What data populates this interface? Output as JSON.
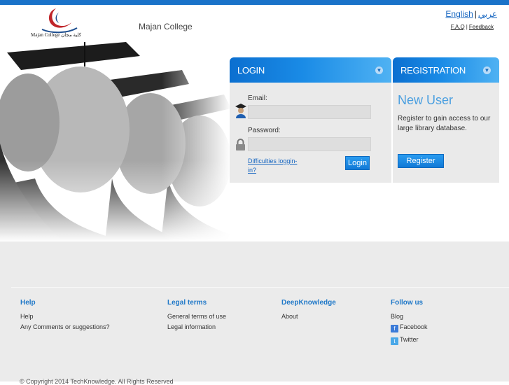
{
  "header": {
    "logo_caption": "Majan College كلية مجان",
    "site_title": "Majan College",
    "lang_english": "English",
    "lang_separator": "|",
    "lang_arabic": "عربي",
    "faq": "F.A.Q",
    "links_separator": "|",
    "feedback": "Feedback"
  },
  "login": {
    "title": "LOGIN",
    "email_label": "Email:",
    "password_label": "Password:",
    "difficulties_link": "Difficulties loggin-in?",
    "login_button": "Login"
  },
  "registration": {
    "title": "REGISTRATION",
    "heading": "New User",
    "text": "Register to gain access to our large library database.",
    "register_button": "Register"
  },
  "footer": {
    "columns": [
      {
        "title": "Help",
        "items": [
          "Help",
          "Any Comments or suggestions?"
        ]
      },
      {
        "title": "Legal terms",
        "items": [
          "General terms of use",
          "Legal information"
        ]
      },
      {
        "title": "DeepKnowledge",
        "items": [
          "About"
        ]
      },
      {
        "title": "Follow us",
        "items": [
          "Blog",
          "Facebook",
          "Twitter"
        ]
      }
    ],
    "copyright": "© Copyright 2014 TechKnowledge. All Rights Reserved"
  },
  "colors": {
    "brand_blue": "#1a73c9",
    "panel_body": "#eaeaea",
    "footer_bg": "#ebebeb",
    "link": "#1565c0"
  },
  "icons": [
    "user-icon",
    "lock-icon",
    "chevron-down-icon",
    "facebook-icon",
    "twitter-icon"
  ]
}
